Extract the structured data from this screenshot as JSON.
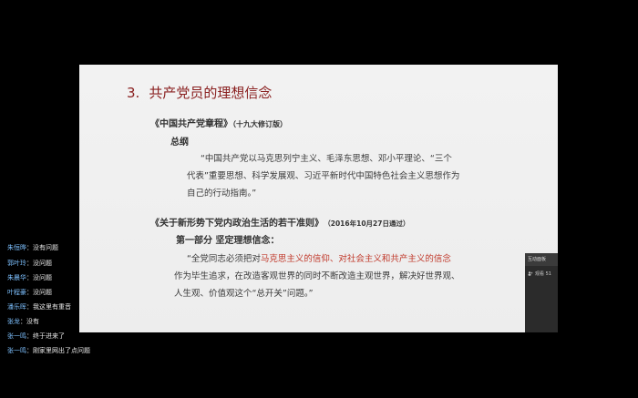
{
  "slide": {
    "number": "3.",
    "title": "共产党员的理想信念",
    "section1": {
      "heading": "《中国共产党章程》",
      "edition": "（十九大修订版）",
      "subheading": "总纲",
      "lines": [
        "“中国共产党以马克思列宁主义、毛泽东思想、邓小平理论、“三个",
        "代表”重要思想、科学发展观、习近平新时代中国特色社会主义思想作为",
        "自己的行动指南。”"
      ]
    },
    "section2": {
      "heading": "《关于新形势下党内政治生活的若干准则》",
      "date": "（2016年10月27日通过）",
      "subheading": "第一部分  坚定理想信念：",
      "line1_prefix": "“全党同志必须把对",
      "line1_highlight": "马克思主义的信仰、对社会主义和共产主义的信念",
      "line2": "作为毕生追求，在改造客观世界的同时不断改造主观世界，解决好世界观、",
      "line3": "人生观、价值观这个“总开关”问题。”"
    }
  },
  "chat": [
    {
      "name": "朱恒晔",
      "msg": "没有问题"
    },
    {
      "name": "郭叶玲",
      "msg": "没问题"
    },
    {
      "name": "朱晨华",
      "msg": "没问题"
    },
    {
      "name": "叶程豪",
      "msg": "没问题"
    },
    {
      "name": "潘乐晖",
      "msg": "我这里有重音"
    },
    {
      "name": "张龙",
      "msg": "没有"
    },
    {
      "name": "张一鸣",
      "msg": "终于进来了"
    },
    {
      "name": "张一鸣",
      "msg": "刚家里网出了点问题"
    }
  ],
  "panel": {
    "title": "互动面板",
    "participants": "观看 51"
  },
  "colors": {
    "background": "#000000",
    "title": "#8a2020",
    "highlight": "#c0392b",
    "chat_name": "#7ec1ff"
  }
}
